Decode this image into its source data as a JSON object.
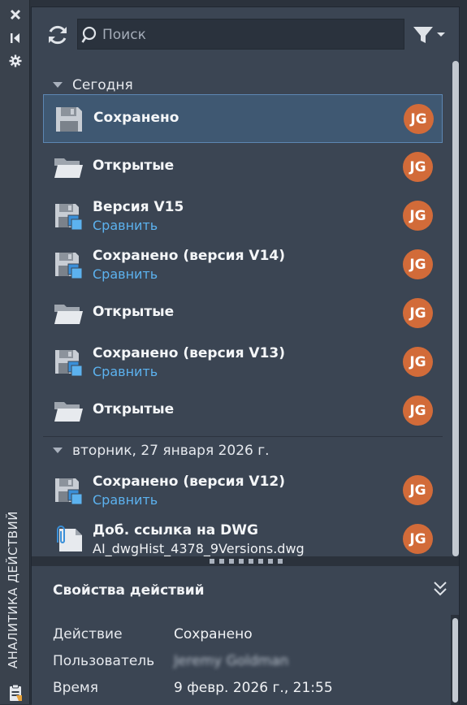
{
  "sidebar": {
    "title": "АНАЛИТИКА ДЕЙСТВИЙ",
    "icons": [
      "close-icon",
      "collapse-icon",
      "settings-icon",
      "clipboard-icon"
    ]
  },
  "toolbar": {
    "refresh_icon": "refresh-icon",
    "search_placeholder": "Поиск",
    "search_value": "",
    "filter_icon": "filter-icon"
  },
  "groups": [
    {
      "label": "Сегодня",
      "items": [
        {
          "title": "Сохранено",
          "link": "",
          "file": "",
          "icon": "save-icon",
          "avatar": "JG",
          "selected": true
        },
        {
          "title": "Открытые",
          "link": "",
          "file": "",
          "icon": "folder-open-icon",
          "avatar": "JG",
          "selected": false
        },
        {
          "title": "Версия V15",
          "link": "Сравнить",
          "file": "",
          "icon": "save-version-icon",
          "avatar": "JG",
          "selected": false
        },
        {
          "title": "Сохранено (версия V14)",
          "link": "Сравнить",
          "file": "",
          "icon": "save-version-icon",
          "avatar": "JG",
          "selected": false
        },
        {
          "title": "Открытые",
          "link": "",
          "file": "",
          "icon": "folder-open-icon",
          "avatar": "JG",
          "selected": false
        },
        {
          "title": "Сохранено (версия V13)",
          "link": "Сравнить",
          "file": "",
          "icon": "save-version-icon",
          "avatar": "JG",
          "selected": false
        },
        {
          "title": "Открытые",
          "link": "",
          "file": "",
          "icon": "folder-open-icon",
          "avatar": "JG",
          "selected": false
        }
      ]
    },
    {
      "label": "вторник, 27 января 2026 г.",
      "items": [
        {
          "title": "Сохранено (версия V12)",
          "link": "Сравнить",
          "file": "",
          "icon": "save-version-icon",
          "avatar": "JG",
          "selected": false
        },
        {
          "title": "Доб. ссылка на DWG",
          "link": "",
          "file": "AI_dwgHist_4378_9Versions.dwg",
          "icon": "attach-dwg-icon",
          "avatar": "JG",
          "selected": false
        }
      ]
    }
  ],
  "properties": {
    "title": "Свойства действий",
    "rows": [
      {
        "label": "Действие",
        "value": "Сохранено",
        "blurred": false
      },
      {
        "label": "Пользователь",
        "value": "Jeremy Goldman",
        "blurred": true
      },
      {
        "label": "Время",
        "value": "9 февр. 2026 г., 21:55",
        "blurred": false
      }
    ]
  },
  "colors": {
    "accent": "#5cb2ef",
    "avatar": "#d26b39",
    "selection": "#3f5872",
    "panel": "#3b4553"
  }
}
